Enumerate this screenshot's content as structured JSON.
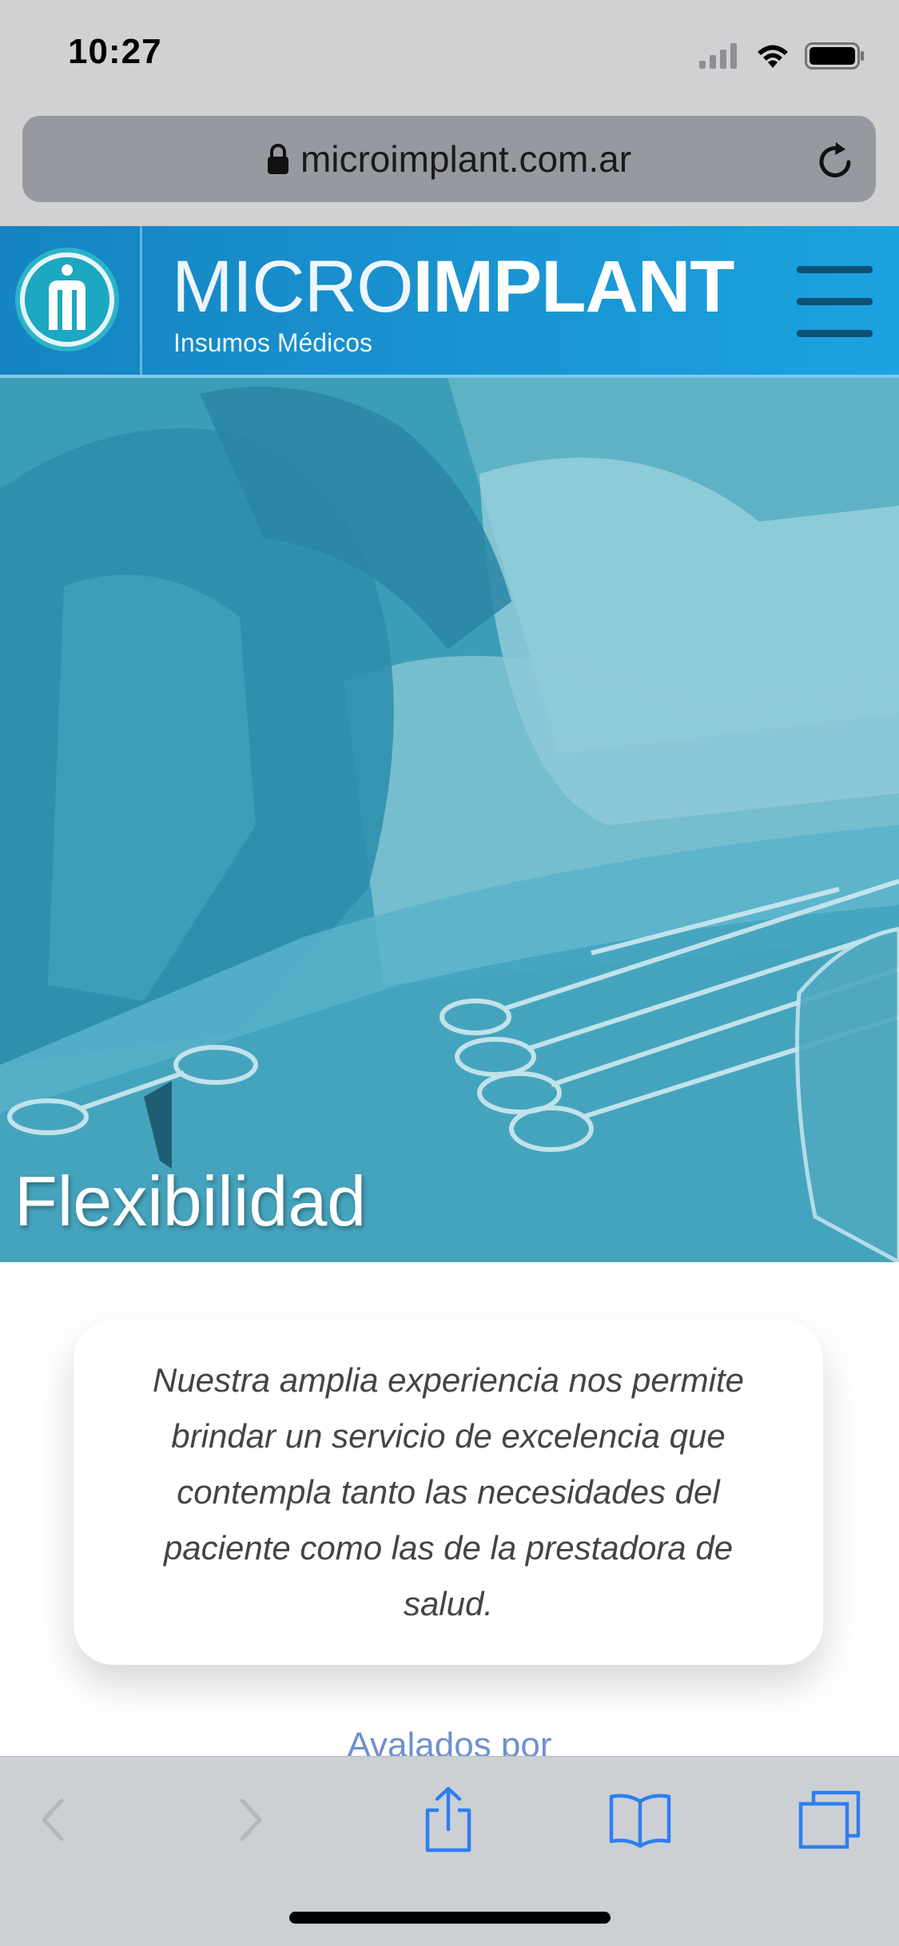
{
  "status_bar": {
    "time": "10:27"
  },
  "browser": {
    "url": "microimplant.com.ar"
  },
  "site_header": {
    "brand_light": "MICRO",
    "brand_bold": "IMPLANT",
    "tagline": "Insumos Médicos"
  },
  "hero": {
    "title": "Flexibilidad"
  },
  "content": {
    "card_text": "Nuestra amplia experiencia nos permite brindar un servicio de excelencia que contempla tanto las necesidades del paciente como las de la prestadora de salud.",
    "next_section_label": "Avalados por"
  },
  "colors": {
    "header_blue": "#1a94d2",
    "hero_tint": "#3a9ab6",
    "ios_blue": "#2f7ef0"
  },
  "icons": [
    "signal-icon",
    "wifi-icon",
    "battery-icon",
    "lock-icon",
    "reload-icon",
    "logo-icon",
    "hamburger-icon",
    "back-icon",
    "forward-icon",
    "share-icon",
    "bookmarks-icon",
    "tabs-icon"
  ]
}
